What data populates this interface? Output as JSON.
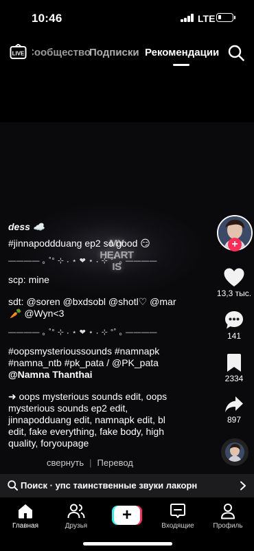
{
  "status_bar": {
    "time": "10:46",
    "network": "LTE",
    "battery_level": 0.15
  },
  "top_nav": {
    "live_label": "LIVE",
    "tabs": [
      {
        "label": "Сообщество"
      },
      {
        "label": "Подписки"
      },
      {
        "label": "Рекомендации"
      }
    ],
    "active_tab_index": 2
  },
  "video": {
    "overlay_text": "MY HEART IS"
  },
  "caption": {
    "username": "dess ☁️",
    "line1": "#jinnapoddduang ep2 so good 😏",
    "divider": "———— ｡ ˚° ⊹ ˖ ⋆ ❤ ⋆ ˖ ⊹ °˚ ｡ ————",
    "scp": "scp: mine",
    "sdt_line1": "sdt: @soren @bxdsobl @shotl♡ @mar",
    "sdt_line2": "🥕 @Wyn<3",
    "tags_line1": "#oopsmysterioussounds #namnapk",
    "tags_line2": "#namna_ntb #pk_pata / @PK_pata",
    "tags_line3": "@Namna Thanthai",
    "seo_line1": "➜ oops mysterious sounds edit, oops",
    "seo_line2": "mysterious sounds ep2 edit,",
    "seo_line3": "jinnapodduang edit, namnapk edit, bl",
    "seo_line4": "edit, fake everything, fake body, high",
    "seo_line5": "quality, foryoupage",
    "collapse_label": "свернуть",
    "translate_label": "Перевод"
  },
  "rail": {
    "likes": "13,3 тыс.",
    "comments": "141",
    "saves": "2334",
    "shares": "897"
  },
  "search_bar": {
    "text": "Поиск · упс таинственные звуки лакорн"
  },
  "bottom_nav": {
    "items": [
      {
        "label": "Главная"
      },
      {
        "label": "Друзья"
      },
      {
        "label": "Входящие"
      },
      {
        "label": "Профиль"
      }
    ]
  },
  "colors": {
    "accent_red": "#fe2c55",
    "accent_cyan": "#25f4ee",
    "background": "#000000"
  }
}
